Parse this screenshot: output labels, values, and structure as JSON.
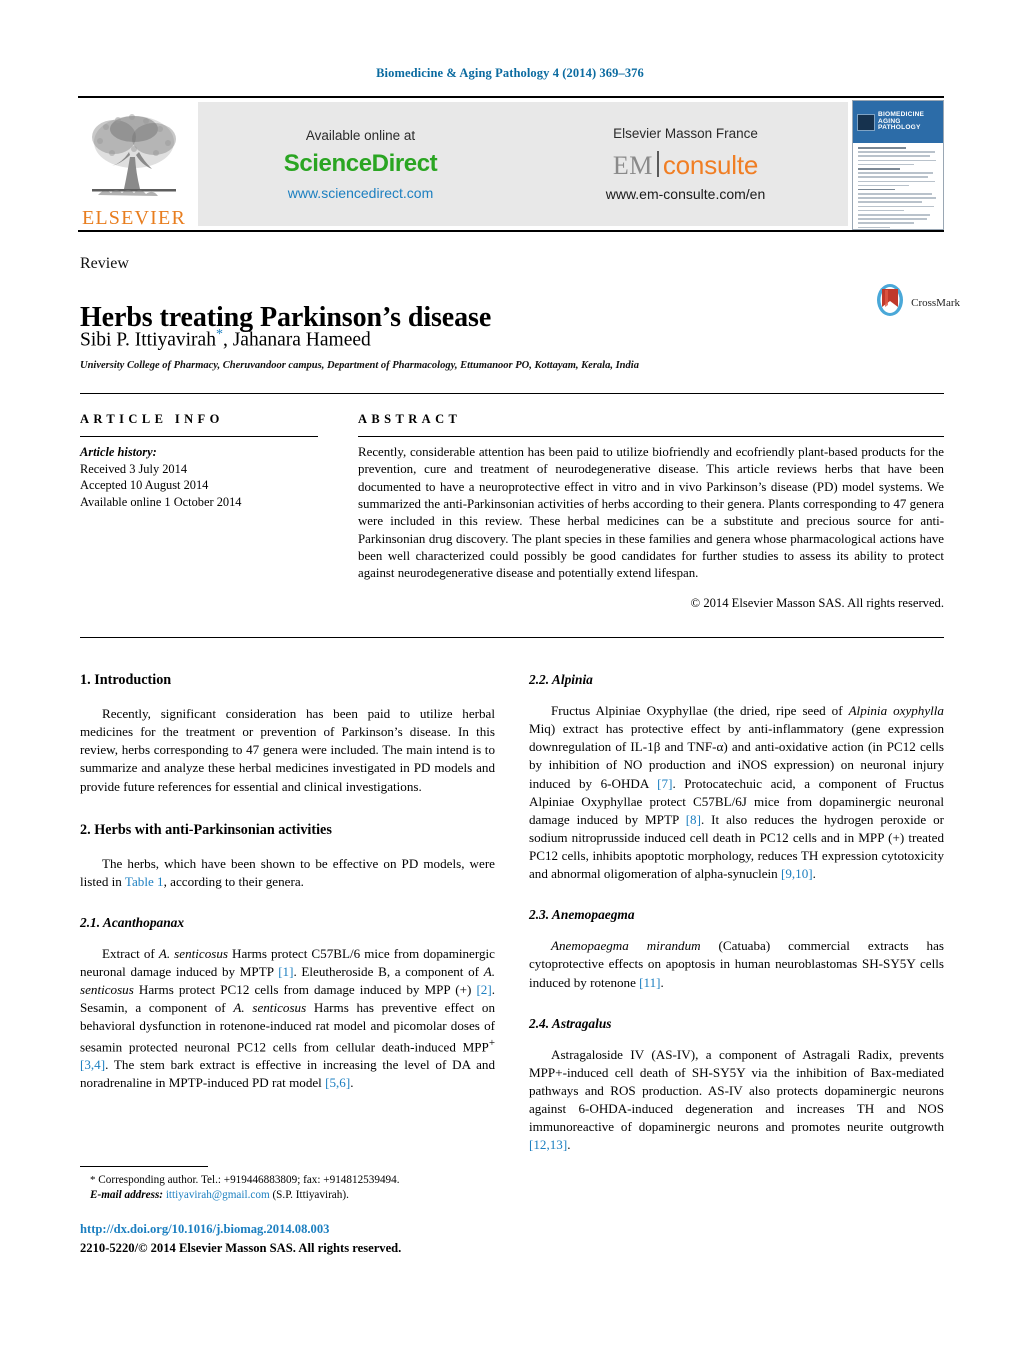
{
  "running_head": "Biomedicine & Aging Pathology 4 (2014) 369–376",
  "masthead": {
    "publisher_logo_text": "ELSEVIER",
    "publisher_logo_icon": "elsevier-tree-icon",
    "available_online_at": "Available online at",
    "sciencedirect_logo": "ScienceDirect",
    "sciencedirect_url": "www.sciencedirect.com",
    "elsevier_masson": "Elsevier Masson France",
    "em_logo_left": "EM",
    "em_logo_right": "consulte",
    "em_url": "www.em-consulte.com/en",
    "cover": {
      "title_line1": "BIOMEDICINE",
      "title_line2": "AGING PATHOLOGY",
      "ampersand": "&"
    }
  },
  "article": {
    "doctype": "Review",
    "title": "Herbs treating Parkinson’s disease",
    "authors_part1": "Sibi P. Ittiyavirah",
    "authors_star": "*",
    "authors_part2": ", Jahanara Hameed",
    "affiliation": "University College of Pharmacy, Cheruvandoor campus, Department of Pharmacology, Ettumanoor PO, Kottayam, Kerala, India",
    "crossmark_label": "CrossMark"
  },
  "article_info": {
    "heading": "ARTICLE INFO",
    "history_label": "Article history:",
    "received": "Received 3 July 2014",
    "accepted": "Accepted 10 August 2014",
    "available_online": "Available online 1 October 2014"
  },
  "abstract": {
    "heading": "ABSTRACT",
    "text": "Recently, considerable attention has been paid to utilize biofriendly and ecofriendly plant-based products for the prevention, cure and treatment of neurodegenerative disease. This article reviews herbs that have been documented to have a neuroprotective effect in vitro and in vivo Parkinson’s disease (PD) model systems. We summarized the anti-Parkinsonian activities of herbs according to their genera. Plants corresponding to 47 genera were included in this review. These herbal medicines can be a substitute and precious source for anti-Parkinsonian drug discovery. The plant species in these families and genera whose pharmacological actions have been well characterized could possibly be good candidates for further studies to assess its ability to protect against neurodegenerative disease and potentially extend lifespan.",
    "copyright": "© 2014 Elsevier Masson SAS. All rights reserved."
  },
  "sections": {
    "intro_heading": "1. Introduction",
    "intro_p1_a": "Recently, significant consideration has been paid to utilize herbal medicines for the treatment or prevention of Parkinson’s disease. In this review, herbs corresponding to 47 genera were included. The main intend is to summarize and analyze these herbal medicines investigated in PD models and provide future references for essential and clinical investigations.",
    "herbs_heading": "2. Herbs with anti-Parkinsonian activities",
    "herbs_p1_a": "The herbs, which have been shown to be effective on PD models, were listed in ",
    "herbs_p1_link": "Table 1",
    "herbs_p1_b": ", according to their genera.",
    "acanthopanax_heading": "2.1. Acanthopanax",
    "acanthopanax_1": "Extract of ",
    "acanthopanax_2": "A. senticosus",
    "acanthopanax_3": " Harms protect C57BL/6 mice from dopaminergic neuronal damage induced by MPTP ",
    "acanthopanax_ref1": "[1]",
    "acanthopanax_4": ". Eleutheroside B, a component of ",
    "acanthopanax_5": "A. senticosus",
    "acanthopanax_6": " Harms protect PC12 cells from damage induced by MPP (+) ",
    "acanthopanax_ref2": "[2]",
    "acanthopanax_7": ". Sesamin, a component of ",
    "acanthopanax_8": "A. senticosus",
    "acanthopanax_9": " Harms has preventive effect on behavioral dysfunction in rotenone-induced rat model and picomolar doses of sesamin protected neuronal PC12 cells from cellular death-induced MPP",
    "acanthopanax_sup": "+",
    "acanthopanax_10": " ",
    "acanthopanax_ref3": "[3,4]",
    "acanthopanax_11": ". The stem bark extract is effective in increasing the level of DA and noradrenaline in MPTP-induced PD rat model ",
    "acanthopanax_ref4": "[5,6]",
    "acanthopanax_12": ".",
    "alpinia_heading": "2.2. Alpinia",
    "alpinia_1": "Fructus Alpiniae Oxyphyllae (the dried, ripe seed of ",
    "alpinia_2": "Alpinia oxyphylla",
    "alpinia_3": " Miq) extract has protective effect by anti-inflammatory (gene expression downregulation of IL-1β and TNF-α) and anti-oxidative action (in PC12 cells by inhibition of NO production and iNOS expression) on neuronal injury induced by 6-OHDA ",
    "alpinia_ref1": "[7]",
    "alpinia_4": ". Protocatechuic acid, a component of Fructus Alpiniae Oxyphyllae protect C57BL/6J mice from dopaminergic neuronal damage induced by MPTP ",
    "alpinia_ref2": "[8]",
    "alpinia_5": ". It also reduces the hydrogen peroxide or sodium nitroprusside induced cell death in PC12 cells and in MPP (+) treated PC12 cells, inhibits apoptotic morphology, reduces TH expression cytotoxicity and abnormal oligomeration of alpha-synuclein ",
    "alpinia_ref3": "[9,10]",
    "alpinia_6": ".",
    "anemopaegma_heading": "2.3. Anemopaegma",
    "anemopaegma_1": "Anemopaegma mirandum",
    "anemopaegma_2": " (Catuaba) commercial extracts has cytoprotective effects on apoptosis in human neuroblastomas SH-SY5Y cells induced by rotenone ",
    "anemopaegma_ref1": "[11]",
    "anemopaegma_3": ".",
    "astragalus_heading": "2.4. Astragalus",
    "astragalus_1": "Astragaloside IV (AS-IV), a component of Astragali Radix, prevents MPP+-induced cell death of SH-SY5Y via the inhibition of Bax-mediated pathways and ROS production. AS-IV also protects dopaminergic neurons against 6-OHDA-induced degeneration and increases TH and NOS immunoreactive of dopaminergic neurons and promotes neurite outgrowth ",
    "astragalus_ref1": "[12,13]",
    "astragalus_2": "."
  },
  "footer": {
    "corresponding_star": "*",
    "corresponding_text": "Corresponding author. Tel.: +919446883809; fax: +914812539494.",
    "email_label": "E-mail address:",
    "email": "ittiyavirah@gmail.com",
    "email_suffix": " (S.P. Ittiyavirah).",
    "doi_url": "http://dx.doi.org/10.1016/j.biomag.2014.08.003",
    "issn_line": "2210-5220/© 2014 Elsevier Masson SAS. All rights reserved."
  },
  "colors": {
    "link_blue": "#1c7fc0",
    "header_blue": "#0b6ba0",
    "elsevier_orange": "#e87d1e",
    "sciencedirect_green": "#2aa522",
    "em_orange": "#f07e24"
  }
}
